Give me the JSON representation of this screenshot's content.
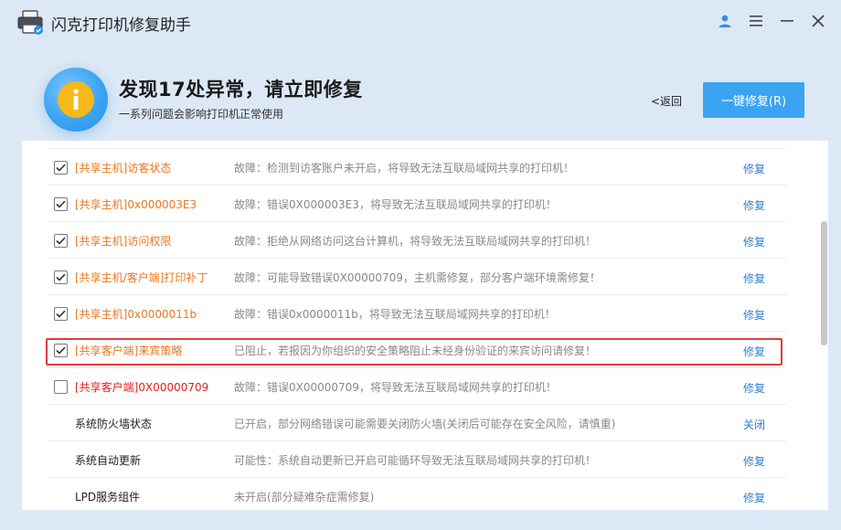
{
  "window": {
    "title": "闪克打印机修复助手"
  },
  "header": {
    "headline": "发现17处异常，请立即修复",
    "subline": "一系列问题会影响打印机正常使用",
    "back_label": "<返回",
    "fix_all_label": "一键修复(R)"
  },
  "colors": {
    "accent": "#3aa4f2",
    "warning_orange": "#e87722",
    "error_red": "#e02020",
    "link_blue": "#2f7fd1",
    "highlight_red": "#e03c3c"
  },
  "rows": [
    {
      "checkbox": "checked",
      "name": "[共享主机]访客状态",
      "name_color": "orange",
      "desc": "故障：检测到访客账户未开启，将导致无法互联局域网共享的打印机！",
      "action": "修复"
    },
    {
      "checkbox": "checked",
      "name": "[共享主机]0x000003E3",
      "name_color": "orange",
      "desc": "故障：错误0X000003E3，将导致无法互联局域网共享的打印机！",
      "action": "修复"
    },
    {
      "checkbox": "checked",
      "name": "[共享主机]访问权限",
      "name_color": "orange",
      "desc": "故障：拒绝从网络访问这台计算机，将导致无法互联局域网共享的打印机！",
      "action": "修复"
    },
    {
      "checkbox": "checked",
      "name": "[共享主机/客户端]打印补丁",
      "name_color": "orange",
      "desc": "故障：可能导致错误0X00000709，主机需修复，部分客户端环境需修复！",
      "action": "修复"
    },
    {
      "checkbox": "checked",
      "name": "[共享主机]0x0000011b",
      "name_color": "orange",
      "desc": "故障：错误0x0000011b，将导致无法互联局域网共享的打印机！",
      "action": "修复"
    },
    {
      "checkbox": "checked",
      "name": "[共享客户端]来宾策略",
      "name_color": "orange",
      "desc": "已阻止，若报因为你组织的安全策略阻止未经身份验证的来宾访问请修复！",
      "action": "修复"
    },
    {
      "checkbox": "unchecked",
      "name": "[共享客户端]0X00000709",
      "name_color": "red",
      "desc": "故障：错误0X00000709，将导致无法互联局域网共享的打印机！",
      "action": "修复"
    },
    {
      "checkbox": "none",
      "name": "系统防火墙状态",
      "name_color": "dark",
      "desc": "已开启，部分网络错误可能需要关闭防火墙(关闭后可能存在安全风险，请慎重)",
      "action": "关闭"
    },
    {
      "checkbox": "none",
      "name": "系统自动更新",
      "name_color": "dark",
      "desc": "可能性：系统自动更新已开启可能循环导致无法互联局域网共享的打印机！",
      "action": "修复"
    },
    {
      "checkbox": "none",
      "name": "LPD服务组件",
      "name_color": "dark",
      "desc": "未开启(部分疑难杂症需修复)",
      "action": "修复"
    }
  ]
}
